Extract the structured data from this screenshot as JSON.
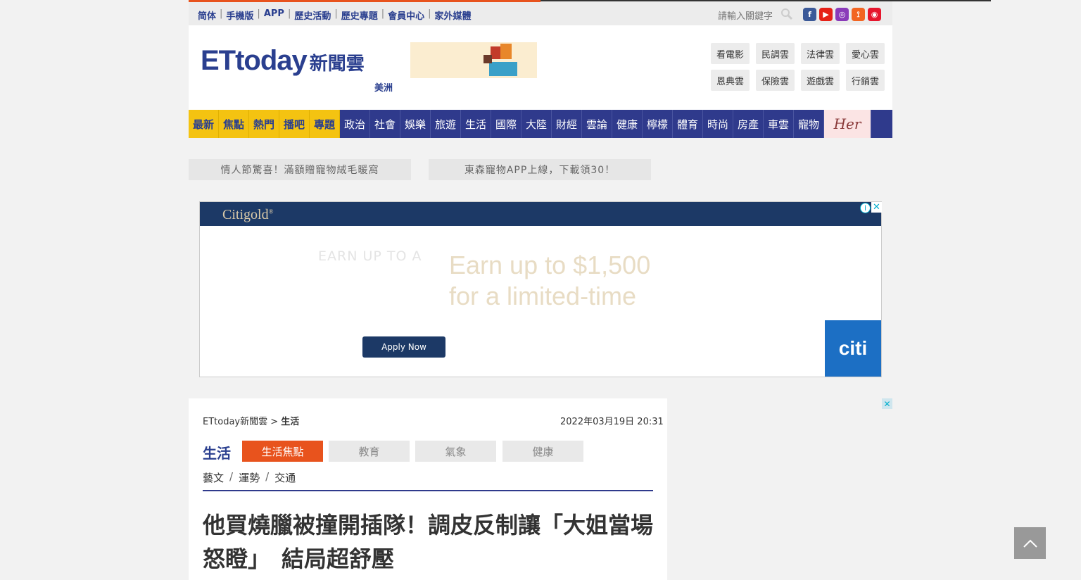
{
  "topbar": {
    "links": [
      "简体",
      "手機版",
      "APP",
      "歷史活動",
      "歷史專題",
      "會員中心",
      "家外媒體"
    ],
    "search_placeholder": "請輸入關鍵字",
    "social_icons": [
      "facebook-icon",
      "youtube-icon",
      "instagram-icon",
      "rss-icon",
      "weibo-icon"
    ]
  },
  "header": {
    "logo_latin": "ETtoday",
    "logo_zh": "新聞雲",
    "region": "美洲",
    "clouds": [
      "看電影",
      "民調雲",
      "法律雲",
      "愛心雲",
      "恩典雲",
      "保險雲",
      "遊戲雲",
      "行銷雲"
    ]
  },
  "nav": {
    "items": [
      "最新",
      "焦點",
      "熱門",
      "播吧",
      "專題",
      "政治",
      "社會",
      "娛樂",
      "旅遊",
      "生活",
      "國際",
      "大陸",
      "財經",
      "雲論",
      "健康",
      "檸檬",
      "體育",
      "時尚",
      "房產",
      "車雲",
      "寵物"
    ],
    "her": "Her"
  },
  "promos": [
    "情人節驚喜！滿額贈寵物絨毛暖窩",
    "東森寵物APP上線，下載領30！"
  ],
  "ad": {
    "brand": "Citigold",
    "brand_mark": "®",
    "small_text": "EARN UP TO A",
    "big_line1": "Earn up to $1,500",
    "big_line2": "for a limited-time",
    "button": "Apply Now",
    "logo": "citi",
    "colors": {
      "navy": "#1c3966",
      "citi_blue": "#1c6fc4"
    }
  },
  "article": {
    "breadcrumb_site": "ETtoday新聞雲 >",
    "breadcrumb_section": "生活",
    "date": "2022年03月19日 20:31",
    "section_title": "生活",
    "tabs": [
      "生活焦點",
      "教育",
      "氣象",
      "健康"
    ],
    "sublinks": [
      "藝文",
      "運勢",
      "交通"
    ],
    "headline_line1": "他買燒臘被撞開插隊！調皮反制讓「大姐當場",
    "headline_line2": "怒瞪」　結局超舒壓"
  },
  "colors": {
    "brand_blue": "#2f3a8c",
    "accent_orange": "#e8531d",
    "nav_yellow": "#f4c311"
  }
}
